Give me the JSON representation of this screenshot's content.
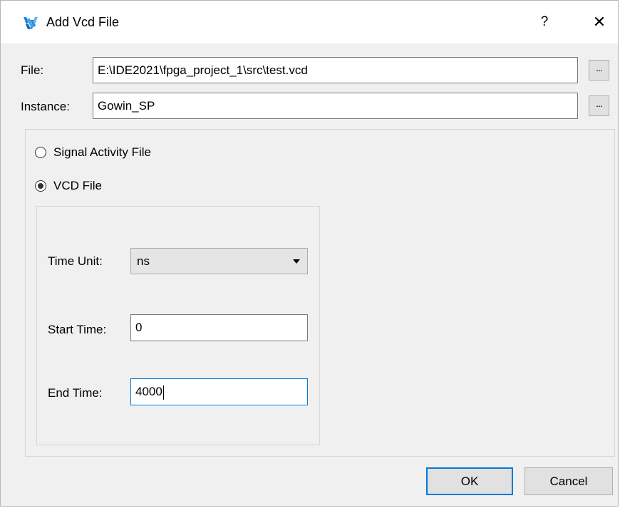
{
  "window": {
    "title": "Add Vcd File",
    "help_label": "?",
    "close_label": "✕",
    "icon": "gowin-logo-icon",
    "accent_color": "#0078d7"
  },
  "file": {
    "label": "File:",
    "value": "E:\\IDE2021\\fpga_project_1\\src\\test.vcd",
    "browse_label": "..."
  },
  "instance": {
    "label": "Instance:",
    "value": "Gowin_SP",
    "browse_label": "..."
  },
  "source_type": {
    "options": [
      {
        "label": "Signal Activity File",
        "checked": false
      },
      {
        "label": "VCD File",
        "checked": true
      }
    ]
  },
  "vcd": {
    "time_unit_label": "Time Unit:",
    "time_unit_value": "ns",
    "start_time_label": "Start Time:",
    "start_time_value": "0",
    "end_time_label": "End Time:",
    "end_time_value": "4000"
  },
  "buttons": {
    "ok_label": "OK",
    "cancel_label": "Cancel"
  }
}
